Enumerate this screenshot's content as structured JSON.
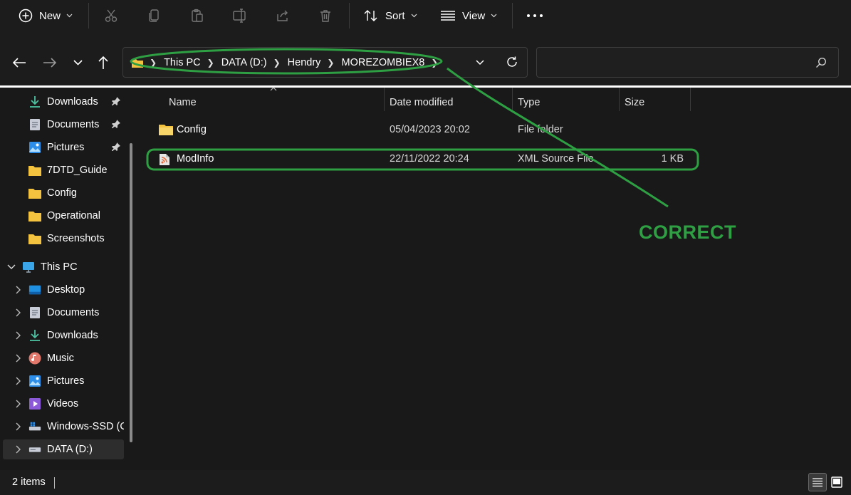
{
  "command_bar": {
    "new_label": "New",
    "sort_label": "Sort",
    "view_label": "View"
  },
  "address_bar": {
    "crumbs": [
      "This PC",
      "DATA (D:)",
      "Hendry",
      "MOREZOMBIEX8"
    ]
  },
  "search": {
    "placeholder": ""
  },
  "nav_pane": {
    "quick_access": [
      {
        "label": "Downloads",
        "icon": "download-arrow-icon",
        "pinned": true
      },
      {
        "label": "Documents",
        "icon": "document-icon",
        "pinned": true
      },
      {
        "label": "Pictures",
        "icon": "pictures-icon",
        "pinned": true
      },
      {
        "label": "7DTD_Guide",
        "icon": "folder-icon"
      },
      {
        "label": "Config",
        "icon": "folder-icon"
      },
      {
        "label": "Operational",
        "icon": "folder-icon"
      },
      {
        "label": "Screenshots",
        "icon": "folder-icon"
      }
    ],
    "this_pc_label": "This PC",
    "this_pc_items": [
      {
        "label": "Desktop",
        "icon": "desktop-icon"
      },
      {
        "label": "Documents",
        "icon": "document-icon"
      },
      {
        "label": "Downloads",
        "icon": "download-arrow-icon"
      },
      {
        "label": "Music",
        "icon": "music-icon"
      },
      {
        "label": "Pictures",
        "icon": "pictures-icon"
      },
      {
        "label": "Videos",
        "icon": "videos-icon"
      },
      {
        "label": "Windows-SSD (C",
        "icon": "drive-c-icon"
      },
      {
        "label": "DATA (D:)",
        "icon": "drive-icon",
        "selected": true
      }
    ]
  },
  "file_list": {
    "columns": [
      "Name",
      "Date modified",
      "Type",
      "Size"
    ],
    "rows": [
      {
        "name": "Config",
        "date": "05/04/2023 20:02",
        "type": "File folder",
        "size": "",
        "icon": "folder-icon"
      },
      {
        "name": "ModInfo",
        "date": "22/11/2022 20:24",
        "type": "XML Source File",
        "size": "1 KB",
        "icon": "xml-file-icon"
      }
    ]
  },
  "annotation": {
    "label": "CORRECT",
    "color": "#2ea043"
  },
  "status_bar": {
    "item_count": "2 items"
  },
  "colors": {
    "background": "#191919",
    "toolbar": "#1c1c1c",
    "folder": "#f3c33f",
    "annotation_green": "#2ea043"
  }
}
